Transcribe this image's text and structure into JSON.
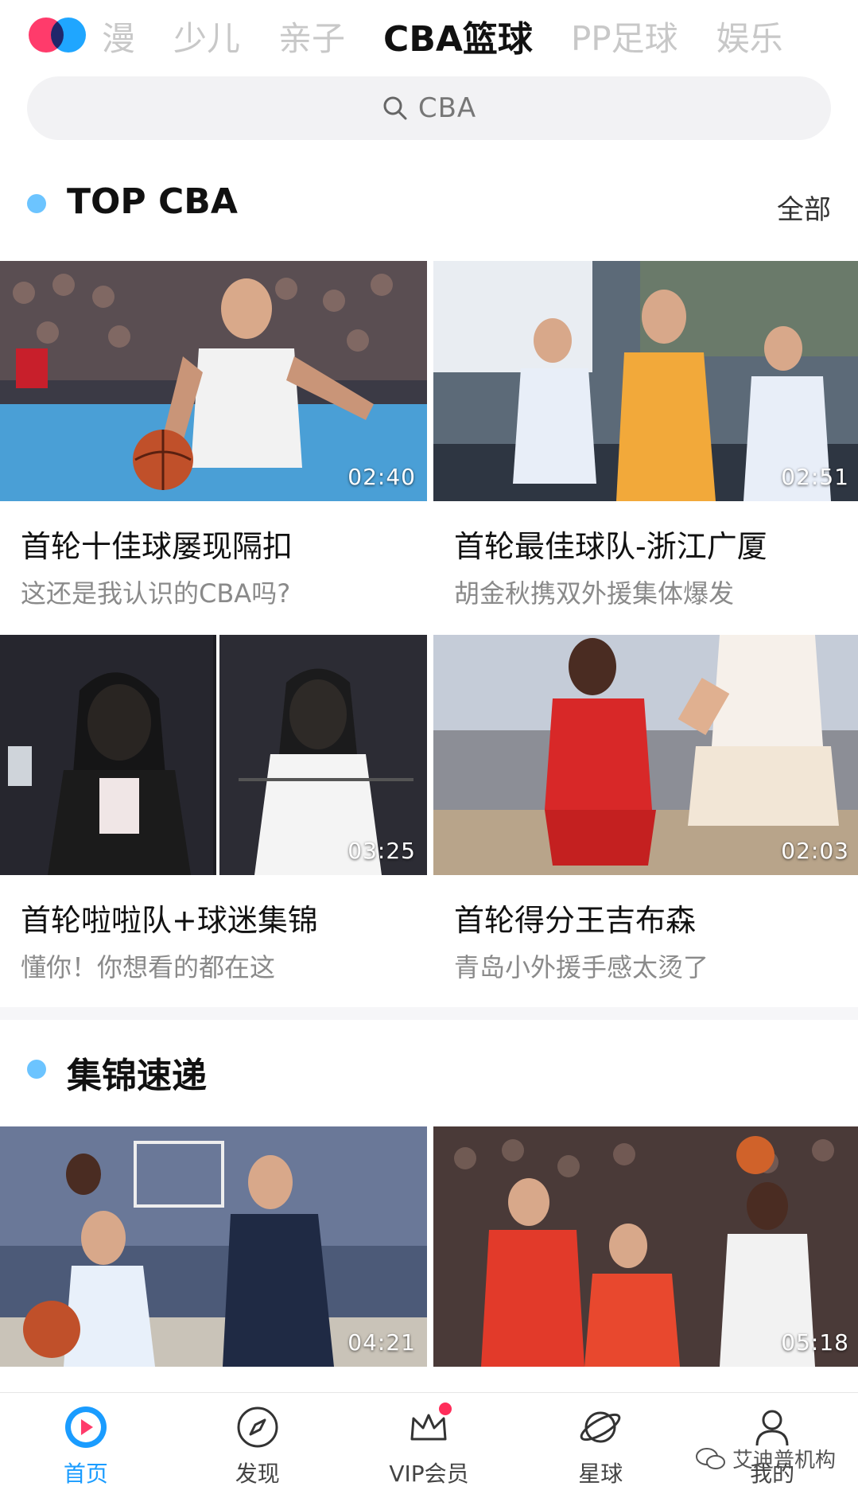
{
  "topbar": {
    "tabs": [
      {
        "label": "漫"
      },
      {
        "label": "少儿"
      },
      {
        "label": "亲子"
      },
      {
        "label": "CBA篮球"
      },
      {
        "label": "PP足球"
      },
      {
        "label": "娱乐"
      }
    ],
    "active_tab": "CBA篮球"
  },
  "search": {
    "placeholder": "CBA"
  },
  "section_top": {
    "title": "TOP CBA",
    "more": "全部"
  },
  "top_videos": [
    {
      "title": "首轮十佳球屡现隔扣",
      "subtitle": "这还是我认识的CBA吗?",
      "duration": "02:40"
    },
    {
      "title": "首轮最佳球队-浙江广厦",
      "subtitle": "胡金秋携双外援集体爆发",
      "duration": "02:51"
    },
    {
      "title": "首轮啦啦队+球迷集锦",
      "subtitle": "懂你！你想看的都在这",
      "duration": "03:25"
    },
    {
      "title": "首轮得分王吉布森",
      "subtitle": "青岛小外援手感太烫了",
      "duration": "02:03"
    }
  ],
  "section_highlights": {
    "title": "集锦速递"
  },
  "highlight_videos": [
    {
      "duration": "04:21"
    },
    {
      "duration": "05:18"
    }
  ],
  "bottom_nav": [
    {
      "label": "首页",
      "icon": "home-play-icon"
    },
    {
      "label": "发现",
      "icon": "compass-icon"
    },
    {
      "label": "VIP会员",
      "icon": "crown-icon"
    },
    {
      "label": "星球",
      "icon": "planet-icon"
    },
    {
      "label": "我的",
      "icon": "person-icon"
    }
  ],
  "watermark": {
    "text": "艾迪普机构"
  },
  "colors": {
    "accent": "#1a9cff",
    "dot": "#6cc4ff",
    "badge": "#ff2d5a"
  }
}
